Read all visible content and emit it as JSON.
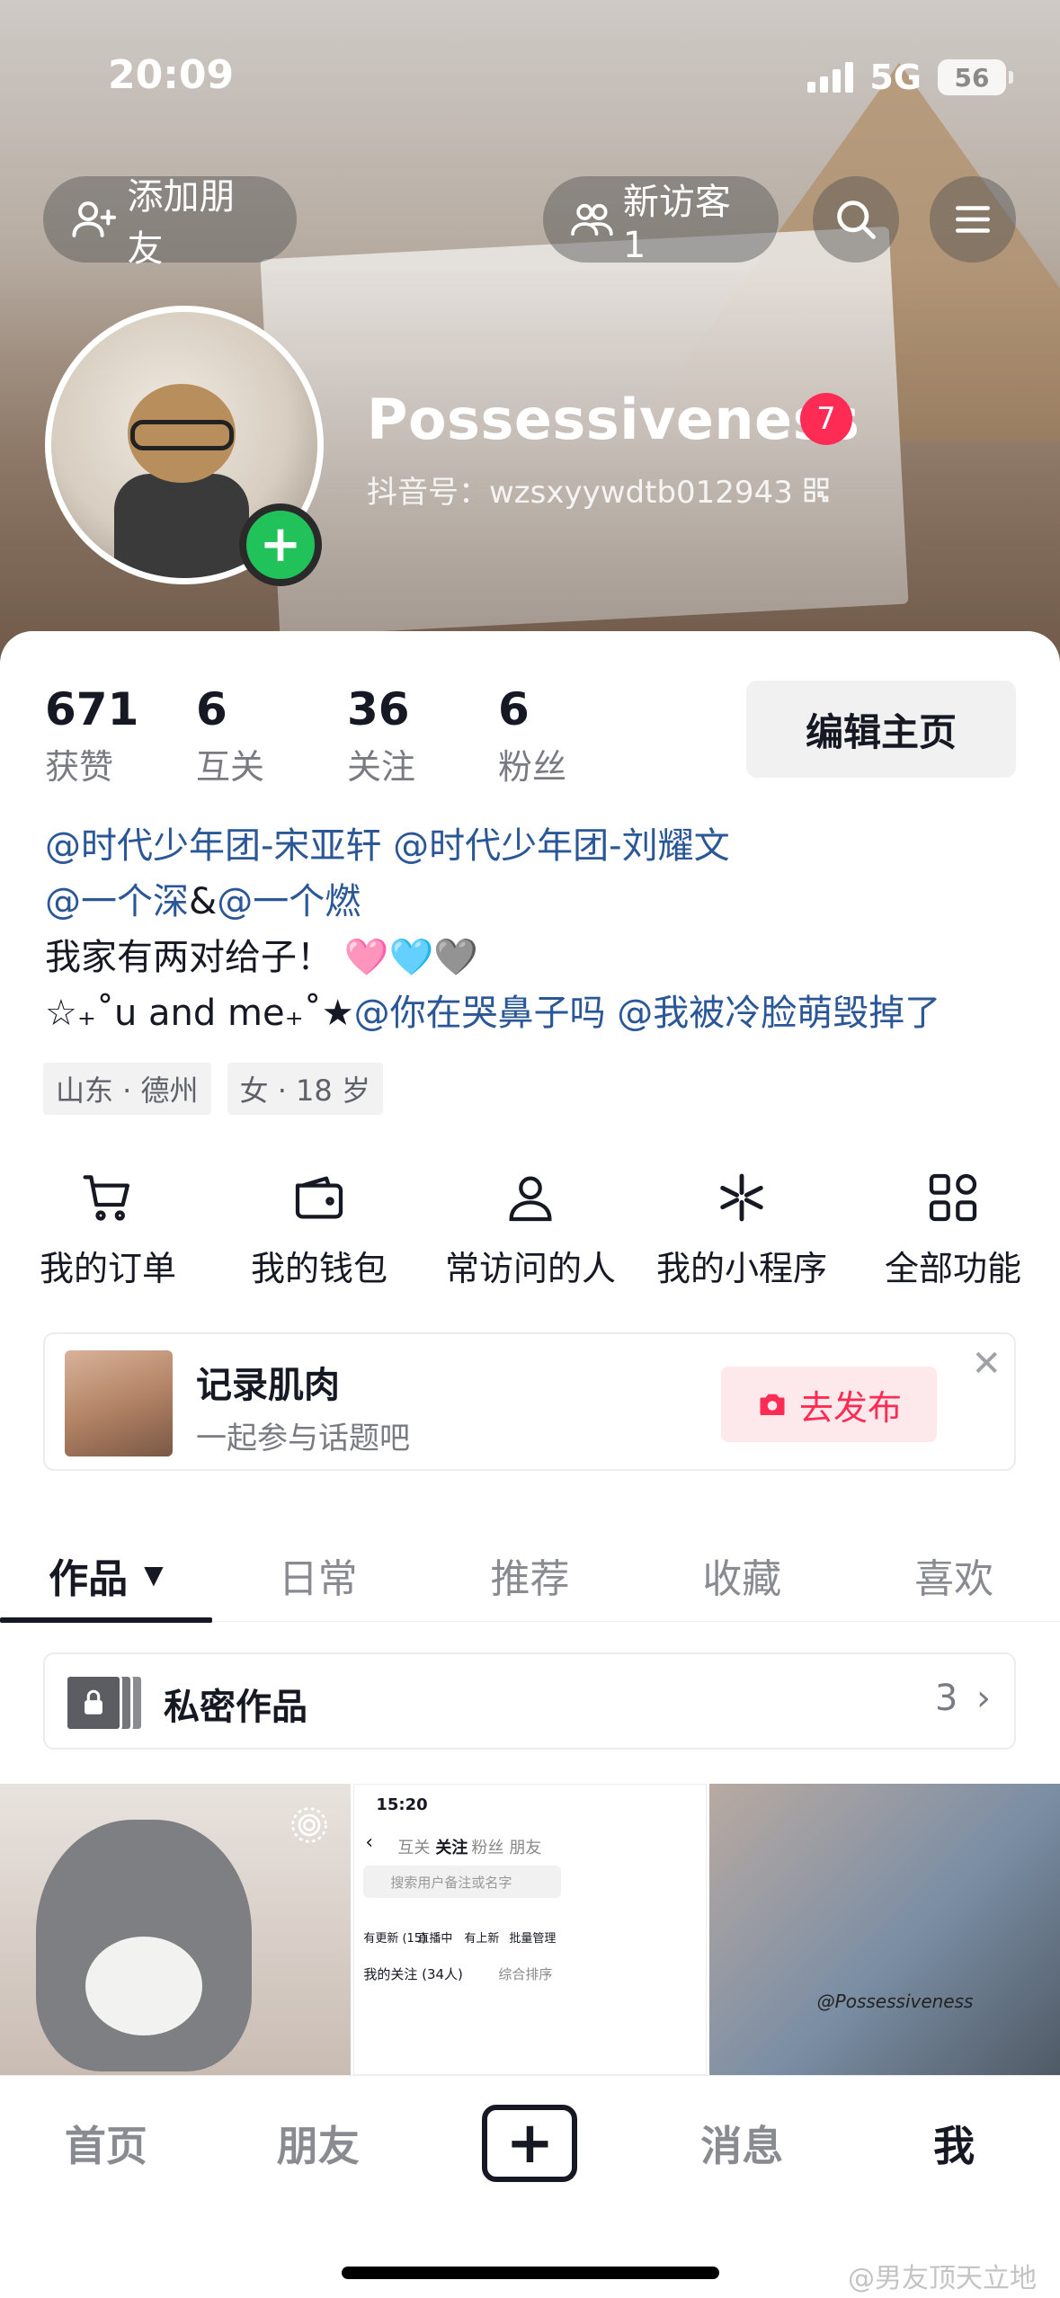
{
  "status_bar": {
    "time": "20:09",
    "network": "5G",
    "battery": "56"
  },
  "header": {
    "add_friend": "添加朋友",
    "new_visitors": "新访客 1"
  },
  "profile": {
    "name": "Possessiveness",
    "badge_count": "7",
    "douyin_id": "抖音号：wzsxyywdtb012943"
  },
  "stats": [
    {
      "value": "671",
      "label": "获赞"
    },
    {
      "value": "6",
      "label": "互关"
    },
    {
      "value": "36",
      "label": "关注"
    },
    {
      "value": "6",
      "label": "粉丝"
    }
  ],
  "edit_profile": "编辑主页",
  "bio": {
    "line1_a": "@时代少年团-宋亚轩",
    "line1_b": "@时代少年团-刘耀文",
    "line2_a": "@一个深",
    "line2_amp": "&",
    "line2_b": "@一个燃",
    "line3": "我家有两对给子！ 🩷🩵🩶",
    "line4_a": "☆₊˚u and me₊˚★",
    "line4_b": "@你在哭鼻子吗",
    "line4_c": "@我被冷脸萌毁掉了"
  },
  "tags": [
    "山东 · 德州",
    "女 · 18 岁"
  ],
  "functions": [
    {
      "label": "我的订单",
      "icon": "cart-icon"
    },
    {
      "label": "我的钱包",
      "icon": "wallet-icon"
    },
    {
      "label": "常访问的人",
      "icon": "person-icon"
    },
    {
      "label": "我的小程序",
      "icon": "asterisk-icon"
    },
    {
      "label": "全部功能",
      "icon": "apps-icon"
    }
  ],
  "promo": {
    "title": "记录肌肉",
    "subtitle": "一起参与话题吧",
    "action": "去发布"
  },
  "tabs": [
    "作品",
    "日常",
    "推荐",
    "收藏",
    "喜欢"
  ],
  "private_works": {
    "label": "私密作品",
    "count": "3"
  },
  "grid": {
    "screenshot_time": "15:20",
    "screenshot_tabs": [
      "互关",
      "关注",
      "粉丝",
      "朋友"
    ],
    "screenshot_search": "搜索用户备注或名字",
    "screenshot_actions": [
      "有更新 (15)",
      "直播中",
      "有上新",
      "批量管理"
    ],
    "screenshot_follow": "我的关注 (34人)",
    "screenshot_sort": "综合排序",
    "photo_caption": "@Possessiveness"
  },
  "bottom_nav": [
    "首页",
    "朋友",
    "消息",
    "我"
  ],
  "watermark": "@男友顶天立地",
  "colors": {
    "accent": "#fe2c55",
    "mention": "#2b5797",
    "add": "#21c25a"
  }
}
